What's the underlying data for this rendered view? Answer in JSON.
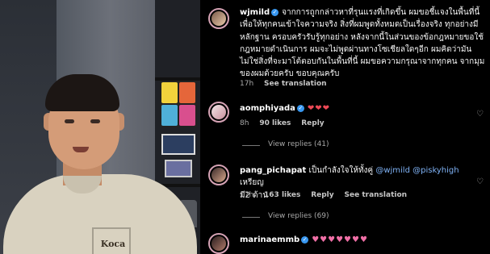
{
  "comments": [
    {
      "username": "wjmild",
      "verified": true,
      "text_lines": [
        "จากการถูกกล่าวหาที่รุนแรงที่เกิดขึ้น ผมขอชี้แจงในพื้นที่นี้",
        "เพื่อให้ทุกคนเข้าใจความจริง สิ่งที่ผมพูดทั้งหมดเป็นเรื่องจริง ทุกอย่างมี",
        "หลักฐาน ครอบครัวรับรู้ทุกอย่าง หลังจากนี้ในส่วนของข้อกฎหมายขอใช้",
        "กฎหมายดำเนินการ ผมจะไม่พูดผ่านทางโซเชียลใดๆอีก ผมคิดว่ามัน",
        "ไม่ใช่สิ่งที่จะมาโต้ตอบกันในพื้นที่นี้ ผมขอความกรุณาจากทุกคน จากมุม",
        "ของผมด้วยครับ ขอบคุณครับ"
      ],
      "time": "17h",
      "likes": "",
      "actions": [
        "See translation"
      ]
    },
    {
      "username": "aomphiyada",
      "verified": true,
      "hearts": "❤❤❤",
      "time": "8h",
      "likes": "90 likes",
      "actions": [
        "Reply"
      ],
      "view_replies": "View replies (41)"
    },
    {
      "username": "pang_pichapat",
      "verified": false,
      "text_before": "เป็นกำลังใจให้ทั้งคู่",
      "mention1": "@wjmild",
      "mention2": "@piskyhigh",
      "text_after": "เหรียญ",
      "text_line2": "มี2 ด้าน",
      "time": "17h",
      "likes": "163 likes",
      "actions": [
        "Reply",
        "See translation"
      ],
      "view_replies": "View replies (69)"
    },
    {
      "username": "marinaemmb",
      "verified": true,
      "hearts": "♥♥♥♥♥♥♥"
    }
  ],
  "video": {
    "shirt_logo": "Koca"
  },
  "colors": {
    "verified": "#3897f0",
    "mention": "#7fb2f5",
    "heart": "#ed4956",
    "meta": "#a8a8a8"
  }
}
